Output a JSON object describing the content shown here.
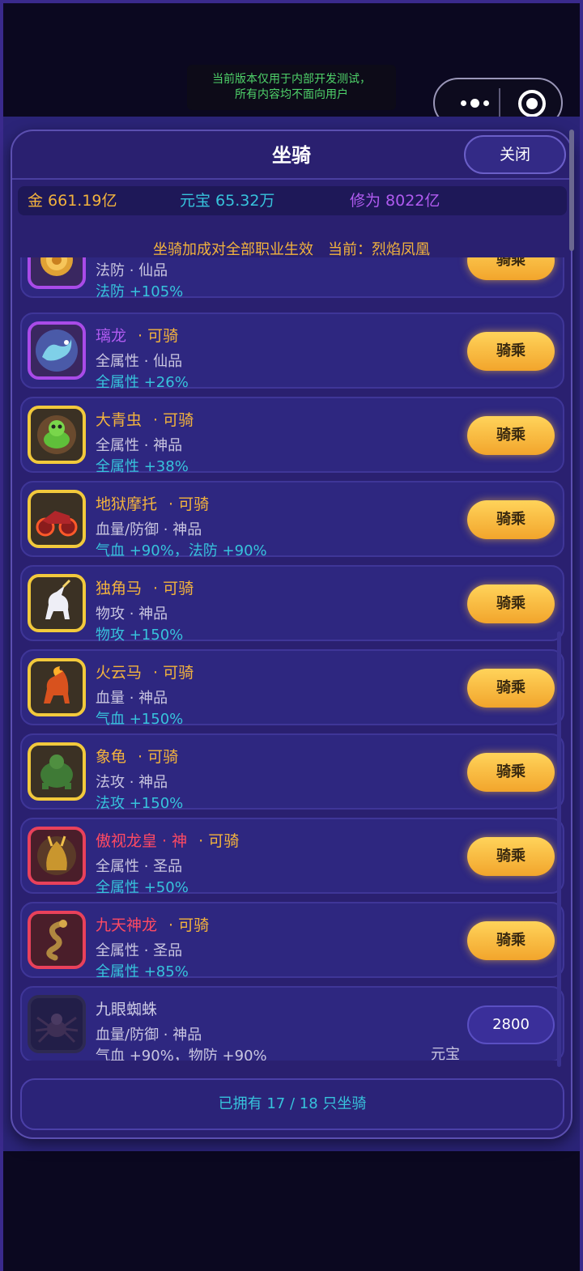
{
  "dev_banner": {
    "line1": "当前版本仅用于内部开发测试，",
    "line2": "所有内容均不面向用户"
  },
  "capsule": {
    "more_icon": "more-dots-icon",
    "close_icon": "target-icon"
  },
  "panel": {
    "title": "坐骑",
    "close_label": "关闭"
  },
  "stats": {
    "gold": "金 661.19亿",
    "yuanbao": "元宝 65.32万",
    "cultivation": "修为 8022亿"
  },
  "note": "坐骑加成对全部职业生效　当前：烈焰凤凰",
  "mounts": [
    {
      "name": "",
      "badge": "",
      "sub": "法防 · 仙品",
      "bonus": "法防 +105%",
      "action": "骑乘",
      "frame": "purple",
      "icon": "golden-flower-icon"
    },
    {
      "name": "璃龙",
      "badge": "· 可骑",
      "sub": "全属性 · 仙品",
      "bonus": "全属性 +26%",
      "action": "骑乘",
      "frame": "purple",
      "icon": "blue-dragon-icon"
    },
    {
      "name": "大青虫",
      "badge": "· 可骑",
      "sub": "全属性 · 神品",
      "bonus": "全属性 +38%",
      "action": "骑乘",
      "frame": "gold",
      "icon": "green-caterpillar-icon"
    },
    {
      "name": "地狱摩托",
      "badge": "· 可骑",
      "sub": "血量/防御 · 神品",
      "bonus": "气血 +90%，法防 +90%",
      "action": "骑乘",
      "frame": "gold",
      "icon": "hell-motorcycle-icon"
    },
    {
      "name": "独角马",
      "badge": "· 可骑",
      "sub": "物攻 · 神品",
      "bonus": "物攻 +150%",
      "action": "骑乘",
      "frame": "gold",
      "icon": "unicorn-icon"
    },
    {
      "name": "火云马",
      "badge": "· 可骑",
      "sub": "血量 · 神品",
      "bonus": "气血 +150%",
      "action": "骑乘",
      "frame": "gold",
      "icon": "fire-horse-icon"
    },
    {
      "name": "象龟",
      "badge": "· 可骑",
      "sub": "法攻 · 神品",
      "bonus": "法攻 +150%",
      "action": "骑乘",
      "frame": "gold",
      "icon": "tortoise-icon"
    },
    {
      "name": "傲视龙皇 · 神",
      "badge": "· 可骑",
      "sub": "全属性 · 圣品",
      "bonus": "全属性 +50%",
      "action": "骑乘",
      "frame": "red",
      "icon": "dragon-emperor-icon"
    },
    {
      "name": "九天神龙",
      "badge": "· 可骑",
      "sub": "全属性 · 圣品",
      "bonus": "全属性 +85%",
      "action": "骑乘",
      "frame": "red",
      "icon": "serpent-dragon-icon"
    },
    {
      "name": "九眼蜘蛛",
      "badge": "",
      "sub": "血量/防御 · 神品",
      "bonus": "气血 +90%，物防 +90%",
      "price": "2800",
      "currency": "元宝",
      "frame": "gray",
      "icon": "spider-icon"
    }
  ],
  "footer": "已拥有 17 / 18 只坐骑",
  "colors": {
    "accent_gold": "#f3b33d",
    "bonus_cyan": "#37c3dc",
    "rare_purple": "#b05bf0",
    "holy_red": "#ff4a62",
    "panel_bg": "#2a2070"
  }
}
